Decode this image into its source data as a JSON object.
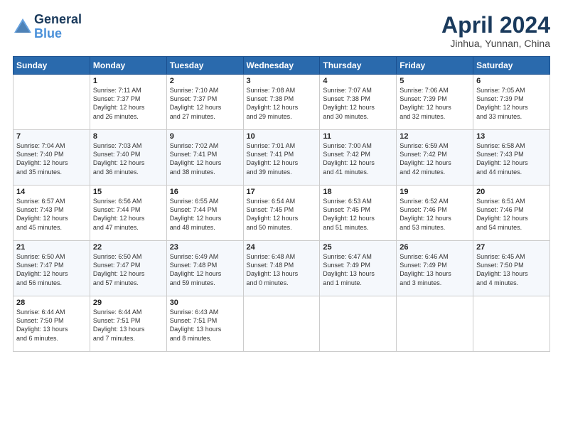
{
  "header": {
    "logo_line1": "General",
    "logo_line2": "Blue",
    "month_title": "April 2024",
    "location": "Jinhua, Yunnan, China"
  },
  "days_of_week": [
    "Sunday",
    "Monday",
    "Tuesday",
    "Wednesday",
    "Thursday",
    "Friday",
    "Saturday"
  ],
  "weeks": [
    [
      {
        "day": "",
        "content": ""
      },
      {
        "day": "1",
        "content": "Sunrise: 7:11 AM\nSunset: 7:37 PM\nDaylight: 12 hours\nand 26 minutes."
      },
      {
        "day": "2",
        "content": "Sunrise: 7:10 AM\nSunset: 7:37 PM\nDaylight: 12 hours\nand 27 minutes."
      },
      {
        "day": "3",
        "content": "Sunrise: 7:08 AM\nSunset: 7:38 PM\nDaylight: 12 hours\nand 29 minutes."
      },
      {
        "day": "4",
        "content": "Sunrise: 7:07 AM\nSunset: 7:38 PM\nDaylight: 12 hours\nand 30 minutes."
      },
      {
        "day": "5",
        "content": "Sunrise: 7:06 AM\nSunset: 7:39 PM\nDaylight: 12 hours\nand 32 minutes."
      },
      {
        "day": "6",
        "content": "Sunrise: 7:05 AM\nSunset: 7:39 PM\nDaylight: 12 hours\nand 33 minutes."
      }
    ],
    [
      {
        "day": "7",
        "content": "Sunrise: 7:04 AM\nSunset: 7:40 PM\nDaylight: 12 hours\nand 35 minutes."
      },
      {
        "day": "8",
        "content": "Sunrise: 7:03 AM\nSunset: 7:40 PM\nDaylight: 12 hours\nand 36 minutes."
      },
      {
        "day": "9",
        "content": "Sunrise: 7:02 AM\nSunset: 7:41 PM\nDaylight: 12 hours\nand 38 minutes."
      },
      {
        "day": "10",
        "content": "Sunrise: 7:01 AM\nSunset: 7:41 PM\nDaylight: 12 hours\nand 39 minutes."
      },
      {
        "day": "11",
        "content": "Sunrise: 7:00 AM\nSunset: 7:42 PM\nDaylight: 12 hours\nand 41 minutes."
      },
      {
        "day": "12",
        "content": "Sunrise: 6:59 AM\nSunset: 7:42 PM\nDaylight: 12 hours\nand 42 minutes."
      },
      {
        "day": "13",
        "content": "Sunrise: 6:58 AM\nSunset: 7:43 PM\nDaylight: 12 hours\nand 44 minutes."
      }
    ],
    [
      {
        "day": "14",
        "content": "Sunrise: 6:57 AM\nSunset: 7:43 PM\nDaylight: 12 hours\nand 45 minutes."
      },
      {
        "day": "15",
        "content": "Sunrise: 6:56 AM\nSunset: 7:44 PM\nDaylight: 12 hours\nand 47 minutes."
      },
      {
        "day": "16",
        "content": "Sunrise: 6:55 AM\nSunset: 7:44 PM\nDaylight: 12 hours\nand 48 minutes."
      },
      {
        "day": "17",
        "content": "Sunrise: 6:54 AM\nSunset: 7:45 PM\nDaylight: 12 hours\nand 50 minutes."
      },
      {
        "day": "18",
        "content": "Sunrise: 6:53 AM\nSunset: 7:45 PM\nDaylight: 12 hours\nand 51 minutes."
      },
      {
        "day": "19",
        "content": "Sunrise: 6:52 AM\nSunset: 7:46 PM\nDaylight: 12 hours\nand 53 minutes."
      },
      {
        "day": "20",
        "content": "Sunrise: 6:51 AM\nSunset: 7:46 PM\nDaylight: 12 hours\nand 54 minutes."
      }
    ],
    [
      {
        "day": "21",
        "content": "Sunrise: 6:50 AM\nSunset: 7:47 PM\nDaylight: 12 hours\nand 56 minutes."
      },
      {
        "day": "22",
        "content": "Sunrise: 6:50 AM\nSunset: 7:47 PM\nDaylight: 12 hours\nand 57 minutes."
      },
      {
        "day": "23",
        "content": "Sunrise: 6:49 AM\nSunset: 7:48 PM\nDaylight: 12 hours\nand 59 minutes."
      },
      {
        "day": "24",
        "content": "Sunrise: 6:48 AM\nSunset: 7:48 PM\nDaylight: 13 hours\nand 0 minutes."
      },
      {
        "day": "25",
        "content": "Sunrise: 6:47 AM\nSunset: 7:49 PM\nDaylight: 13 hours\nand 1 minute."
      },
      {
        "day": "26",
        "content": "Sunrise: 6:46 AM\nSunset: 7:49 PM\nDaylight: 13 hours\nand 3 minutes."
      },
      {
        "day": "27",
        "content": "Sunrise: 6:45 AM\nSunset: 7:50 PM\nDaylight: 13 hours\nand 4 minutes."
      }
    ],
    [
      {
        "day": "28",
        "content": "Sunrise: 6:44 AM\nSunset: 7:50 PM\nDaylight: 13 hours\nand 6 minutes."
      },
      {
        "day": "29",
        "content": "Sunrise: 6:44 AM\nSunset: 7:51 PM\nDaylight: 13 hours\nand 7 minutes."
      },
      {
        "day": "30",
        "content": "Sunrise: 6:43 AM\nSunset: 7:51 PM\nDaylight: 13 hours\nand 8 minutes."
      },
      {
        "day": "",
        "content": ""
      },
      {
        "day": "",
        "content": ""
      },
      {
        "day": "",
        "content": ""
      },
      {
        "day": "",
        "content": ""
      }
    ]
  ]
}
